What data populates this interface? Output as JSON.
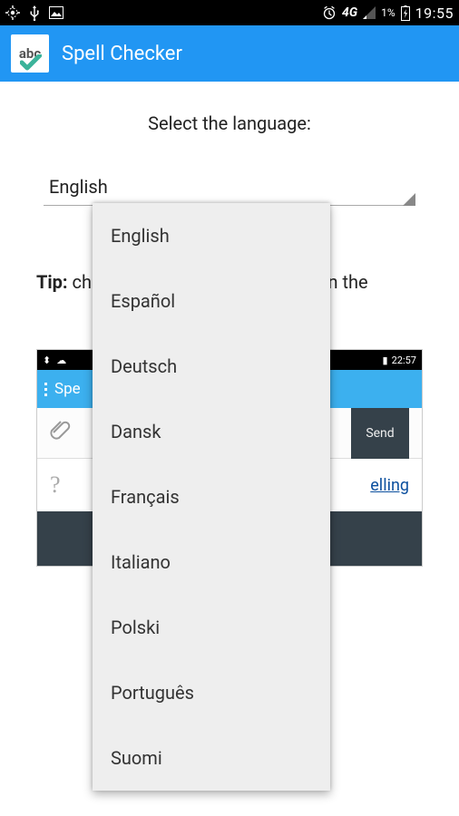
{
  "status": {
    "clock": "19:55",
    "network_label": "4G",
    "battery_pct": "1%"
  },
  "app": {
    "title": "Spell Checker",
    "icon_text": "abc"
  },
  "main": {
    "heading": "Select the language:",
    "selected_language": "English",
    "tip_label": "Tip:",
    "tip_before": " ch",
    "tip_after": "ore, in the"
  },
  "dropdown": {
    "items": [
      "English",
      "Español",
      "Deutsch",
      "Dansk",
      "Français",
      "Italiano",
      "Polski",
      "Português",
      "Suomi"
    ]
  },
  "thumb": {
    "clock": "22:57",
    "app_title": "Spe",
    "send": "Send",
    "link_text": "elling"
  }
}
